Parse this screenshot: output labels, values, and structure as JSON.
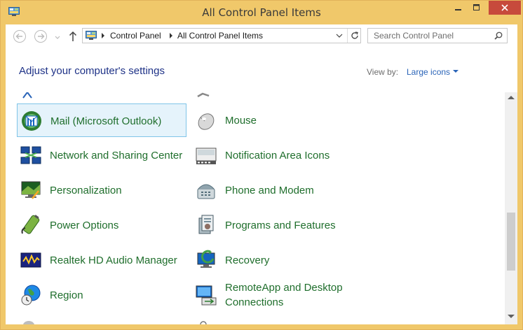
{
  "window": {
    "title": "All Control Panel Items"
  },
  "navigation": {
    "breadcrumb": [
      "Control Panel",
      "All Control Panel Items"
    ],
    "search_placeholder": "Search Control Panel"
  },
  "header": {
    "title": "Adjust your computer's settings",
    "view_by_label": "View by:",
    "view_by_value": "Large icons"
  },
  "items": [
    {
      "label": "Mail (Microsoft Outlook)",
      "icon": "mail-icon",
      "selected": true
    },
    {
      "label": "Mouse",
      "icon": "mouse-icon"
    },
    {
      "label": "Network and Sharing Center",
      "icon": "network-icon"
    },
    {
      "label": "Notification Area Icons",
      "icon": "notification-icon"
    },
    {
      "label": "Personalization",
      "icon": "personalization-icon"
    },
    {
      "label": "Phone and Modem",
      "icon": "phone-icon"
    },
    {
      "label": "Power Options",
      "icon": "power-icon"
    },
    {
      "label": "Programs and Features",
      "icon": "programs-icon"
    },
    {
      "label": "Realtek HD Audio Manager",
      "icon": "audio-icon"
    },
    {
      "label": "Recovery",
      "icon": "recovery-icon"
    },
    {
      "label": "Region",
      "icon": "region-icon"
    },
    {
      "label": "RemoteApp and Desktop Connections",
      "icon": "remoteapp-icon"
    }
  ],
  "colors": {
    "titlebar": "#f0c86a",
    "close_button": "#c74a3c",
    "item_text": "#1f6e2c",
    "header_text": "#1e3287",
    "link_text": "#2a64b8"
  }
}
